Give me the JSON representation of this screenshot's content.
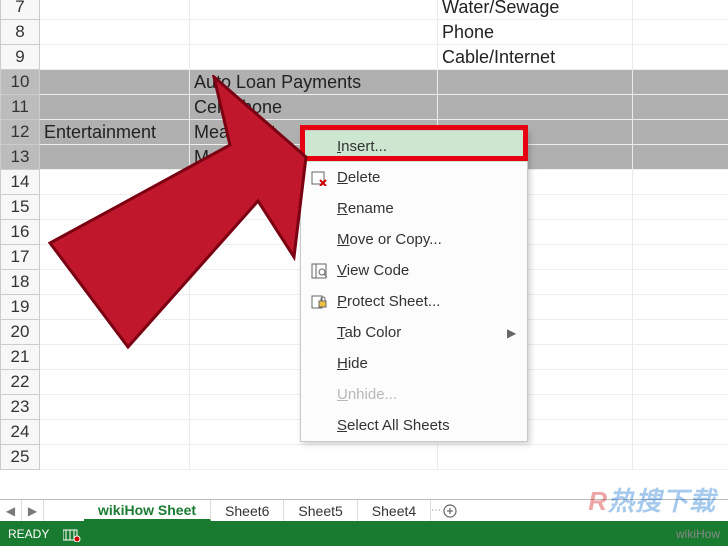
{
  "rows": [
    {
      "n": "7",
      "sel": false,
      "A": "",
      "B": "",
      "C": "Water/Sewage",
      "D": "",
      "overlayC": true
    },
    {
      "n": "8",
      "sel": false,
      "A": "",
      "B": "",
      "C": "Phone",
      "D": "",
      "overlayC": true
    },
    {
      "n": "9",
      "sel": false,
      "A": "",
      "B": "",
      "C": "Cable/Internet",
      "D": "",
      "overlayC": true
    },
    {
      "n": "10",
      "sel": true,
      "A": "",
      "B": "Auto Loan Payments",
      "C": "",
      "D": ""
    },
    {
      "n": "11",
      "sel": true,
      "A": "",
      "B": "Cell Phone",
      "C": "",
      "D": ""
    },
    {
      "n": "12",
      "sel": true,
      "A": "Entertainment",
      "B": "Meals Out",
      "C": "",
      "D": ""
    },
    {
      "n": "13",
      "sel": true,
      "A": "",
      "B": "Movi",
      "C": "",
      "D": ""
    },
    {
      "n": "14",
      "sel": false,
      "A": "",
      "B": "",
      "C": "",
      "D": ""
    },
    {
      "n": "15",
      "sel": false,
      "A": "",
      "B": "",
      "C": "",
      "D": ""
    },
    {
      "n": "16",
      "sel": false,
      "A": "",
      "B": "",
      "C": "",
      "D": ""
    },
    {
      "n": "17",
      "sel": false,
      "A": "",
      "B": "",
      "C": "",
      "D": ""
    },
    {
      "n": "18",
      "sel": false,
      "A": "",
      "B": "",
      "C": "",
      "D": ""
    },
    {
      "n": "19",
      "sel": false,
      "A": "",
      "B": "",
      "C": "",
      "D": ""
    },
    {
      "n": "20",
      "sel": false,
      "A": "",
      "B": "",
      "C": "",
      "D": ""
    },
    {
      "n": "21",
      "sel": false,
      "A": "",
      "B": "",
      "C": "",
      "D": ""
    },
    {
      "n": "22",
      "sel": false,
      "A": "",
      "B": "",
      "C": "",
      "D": ""
    },
    {
      "n": "23",
      "sel": false,
      "A": "",
      "B": "",
      "C": "",
      "D": ""
    },
    {
      "n": "24",
      "sel": false,
      "A": "",
      "B": "",
      "C": "",
      "D": ""
    },
    {
      "n": "25",
      "sel": false,
      "A": "",
      "B": "",
      "C": "",
      "D": ""
    }
  ],
  "ctx": {
    "insert": "Insert...",
    "delete": "Delete",
    "rename": "Rename",
    "move": "Move or Copy...",
    "viewcode": "View Code",
    "protect": "Protect Sheet...",
    "tabcolor": "Tab Color",
    "hide": "Hide",
    "unhide": "Unhide...",
    "selectall": "Select All Sheets"
  },
  "tabs": {
    "active": "wikiHow Sheet",
    "t2": "Sheet6",
    "t3": "Sheet5",
    "t4": "Sheet4"
  },
  "status": {
    "ready": "READY"
  },
  "watermark": "wikiHow",
  "wm2a": "R",
  "wm2b": "热搜下载"
}
